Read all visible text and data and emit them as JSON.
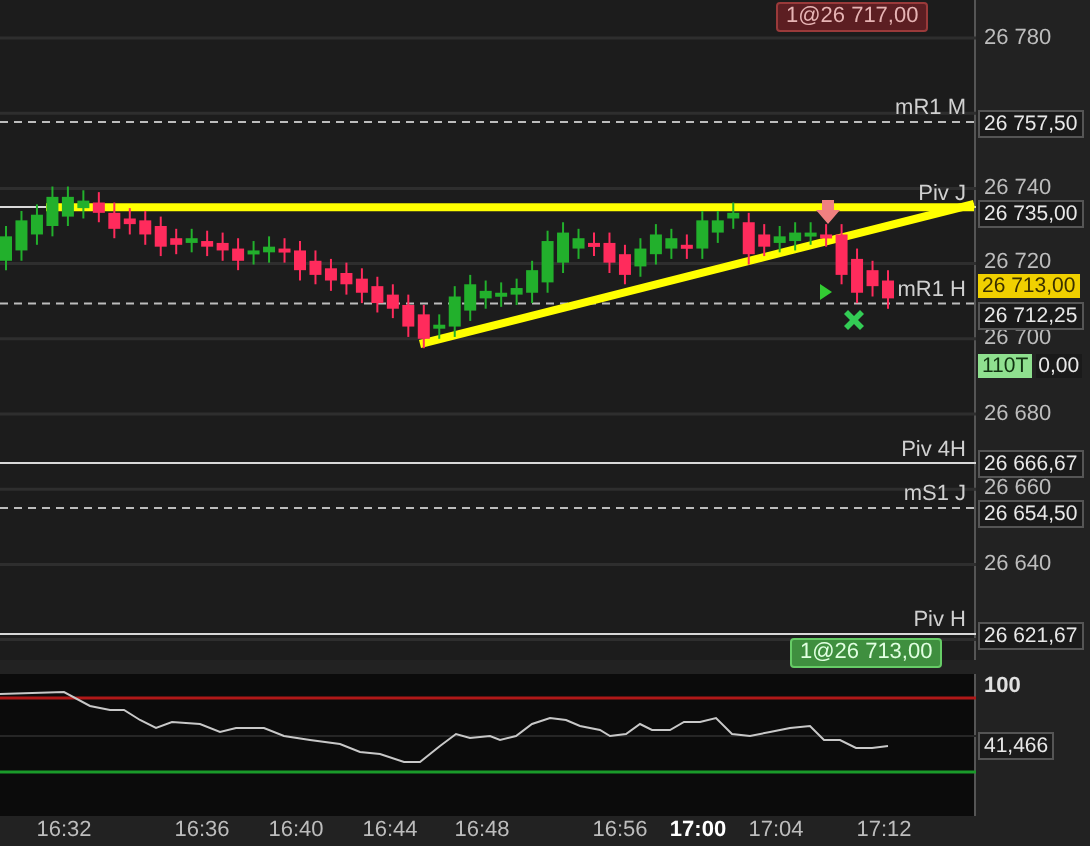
{
  "order_badges": [
    {
      "text": "1@26 717,00",
      "kind": "sell"
    },
    {
      "text": "1@26 713,00",
      "kind": "buy"
    }
  ],
  "price_chart": {
    "chart_data": {
      "type": "candlestick",
      "categories": [
        null,
        null,
        null,
        null,
        null,
        null,
        null,
        null,
        null,
        null,
        null,
        null,
        null,
        null,
        null,
        null,
        null,
        null,
        null,
        null,
        null,
        null,
        null,
        null,
        null,
        null,
        null,
        null,
        null,
        null,
        null,
        null,
        null,
        null,
        null,
        null,
        null,
        null,
        null,
        null,
        null,
        null,
        null,
        null,
        null,
        null,
        null,
        null,
        null,
        null,
        null,
        null,
        null,
        null,
        null,
        null,
        null,
        null
      ],
      "yticks": [
        {
          "value": 26780,
          "label": "26 780"
        },
        {
          "value": 26740,
          "label": "26 740"
        },
        {
          "value": 26720,
          "label": "26 720"
        },
        {
          "value": 26700,
          "label": "26 700"
        },
        {
          "value": 26680,
          "label": "26 680"
        },
        {
          "value": 26660,
          "label": "26 660"
        },
        {
          "value": 26640,
          "label": "26 640"
        }
      ],
      "ylim": [
        26620,
        26790
      ],
      "grid": true,
      "ref_lines": [
        {
          "axis": "y",
          "value": 26735,
          "color": "#ffff00"
        }
      ],
      "ohlc": [
        [
          26720.75,
          26730,
          26718.25,
          26727.25
        ],
        [
          26723.5,
          26734,
          26720.75,
          26731.5
        ],
        [
          26727.75,
          26735.75,
          26725,
          26733
        ],
        [
          26730,
          26740.5,
          26727.25,
          26737.75
        ],
        [
          26732.5,
          26740.5,
          26730,
          26737.75
        ],
        [
          26734.75,
          26739.5,
          26732,
          26736.75
        ],
        [
          26736.25,
          26739,
          26731,
          26733.5
        ],
        [
          26733.5,
          26736.25,
          26726.75,
          26729.25
        ],
        [
          26732,
          26734.75,
          26727.75,
          26730.5
        ],
        [
          26731.5,
          26734,
          26725,
          26727.75
        ],
        [
          26730,
          26732.5,
          26722,
          26724.5
        ],
        [
          26726.75,
          26729.25,
          26722.5,
          26725
        ],
        [
          26725.5,
          26729.25,
          26723,
          26726.75
        ],
        [
          26726,
          26728.75,
          26722,
          26724.5
        ],
        [
          26725.5,
          26728.25,
          26720.75,
          26723.5
        ],
        [
          26724,
          26726.75,
          26718.25,
          26720.75
        ],
        [
          26722.5,
          26726,
          26719.75,
          26723.5
        ],
        [
          26723,
          26727.25,
          26720.25,
          26724.5
        ],
        [
          26724,
          26726.75,
          26720.25,
          26723
        ],
        [
          26723.5,
          26726,
          26715.5,
          26718.25
        ],
        [
          26720.75,
          26723.5,
          26714.5,
          26717
        ],
        [
          26718.75,
          26721.25,
          26712.75,
          26715.5
        ],
        [
          26717.5,
          26720.25,
          26711.75,
          26714.5
        ],
        [
          26716,
          26718.75,
          26709.5,
          26712.25
        ],
        [
          26714,
          26716.5,
          26707,
          26709.5
        ],
        [
          26711.75,
          26714.5,
          26705.5,
          26708
        ],
        [
          26709,
          26711.75,
          26700.5,
          26703.25
        ],
        [
          26706.5,
          26709,
          26697.5,
          26700
        ],
        [
          26702.75,
          26706.5,
          26700,
          26703.75
        ],
        [
          26703.25,
          26714,
          26700.5,
          26711.25
        ],
        [
          26707.5,
          26717,
          26704.75,
          26714.5
        ],
        [
          26710.75,
          26715.5,
          26708,
          26712.75
        ],
        [
          26711.25,
          26715,
          26708.5,
          26712.25
        ],
        [
          26711.75,
          26716,
          26709,
          26713.5
        ],
        [
          26712.25,
          26720.75,
          26709.5,
          26718.25
        ],
        [
          26715,
          26728.75,
          26712.25,
          26726
        ],
        [
          26720.25,
          26731,
          26717.5,
          26728.25
        ],
        [
          26724,
          26729.25,
          26721.25,
          26726.75
        ],
        [
          26725.5,
          26728.25,
          26722,
          26724.5
        ],
        [
          26725.5,
          26728.25,
          26717.5,
          26720.25
        ],
        [
          26722.5,
          26725,
          26714.5,
          26717
        ],
        [
          26719.25,
          26726.75,
          26716.5,
          26724
        ],
        [
          26722.5,
          26730.5,
          26719.75,
          26727.75
        ],
        [
          26724,
          26729.25,
          26721.25,
          26726.75
        ],
        [
          26725,
          26727.75,
          26721.25,
          26724
        ],
        [
          26724,
          26734,
          26721.25,
          26731.5
        ],
        [
          26728.25,
          26734,
          26725.5,
          26731.5
        ],
        [
          26732,
          26736.25,
          26729.25,
          26733.5
        ],
        [
          26731,
          26733.5,
          26719.75,
          26722.5
        ],
        [
          26727.75,
          26730.5,
          26722,
          26724.5
        ],
        [
          26725.5,
          26730,
          26723,
          26727.25
        ],
        [
          26726,
          26731,
          26723.5,
          26728.25
        ],
        [
          26727.75,
          26731,
          26725,
          26728.25
        ],
        [
          26727.75,
          26730.5,
          26724.5,
          26727.25
        ],
        [
          26727.75,
          26730.5,
          26714.5,
          26717
        ],
        [
          26721.25,
          26724,
          26709.5,
          26712.25
        ],
        [
          26718.25,
          26720.75,
          26711.25,
          26714
        ],
        [
          26715.5,
          26718.25,
          26708,
          26710.75
        ]
      ]
    }
  },
  "level_lines": [
    {
      "label": "mR1 M",
      "price": "26 757,50",
      "kind": "dashed"
    },
    {
      "label": "Piv J",
      "price": "26 735,00",
      "kind": "solid"
    },
    {
      "label": "mR1 H",
      "price": "26 712,25",
      "kind": "dashed"
    },
    {
      "label": "Piv 4H",
      "price": "26 666,67",
      "kind": "solid"
    },
    {
      "label": "mS1 J",
      "price": "26 654,50",
      "kind": "dashed"
    },
    {
      "label": "Piv H",
      "price": "26 621,67",
      "kind": "solid"
    }
  ],
  "price_axis": {
    "last_price": "26 713,00",
    "volume_tag": "110T",
    "volume_price": "0,00"
  },
  "indicator": {
    "axis_label": "100",
    "value": "41,466"
  },
  "time_axis": [
    {
      "label": "16:32",
      "bold": false
    },
    {
      "label": "16:36",
      "bold": false
    },
    {
      "label": "16:40",
      "bold": false
    },
    {
      "label": "16:44",
      "bold": false
    },
    {
      "label": "16:48",
      "bold": false
    },
    {
      "label": "16:56",
      "bold": false
    },
    {
      "label": "17:00",
      "bold": true
    },
    {
      "label": "17:04",
      "bold": false
    },
    {
      "label": "17:12",
      "bold": false
    }
  ]
}
